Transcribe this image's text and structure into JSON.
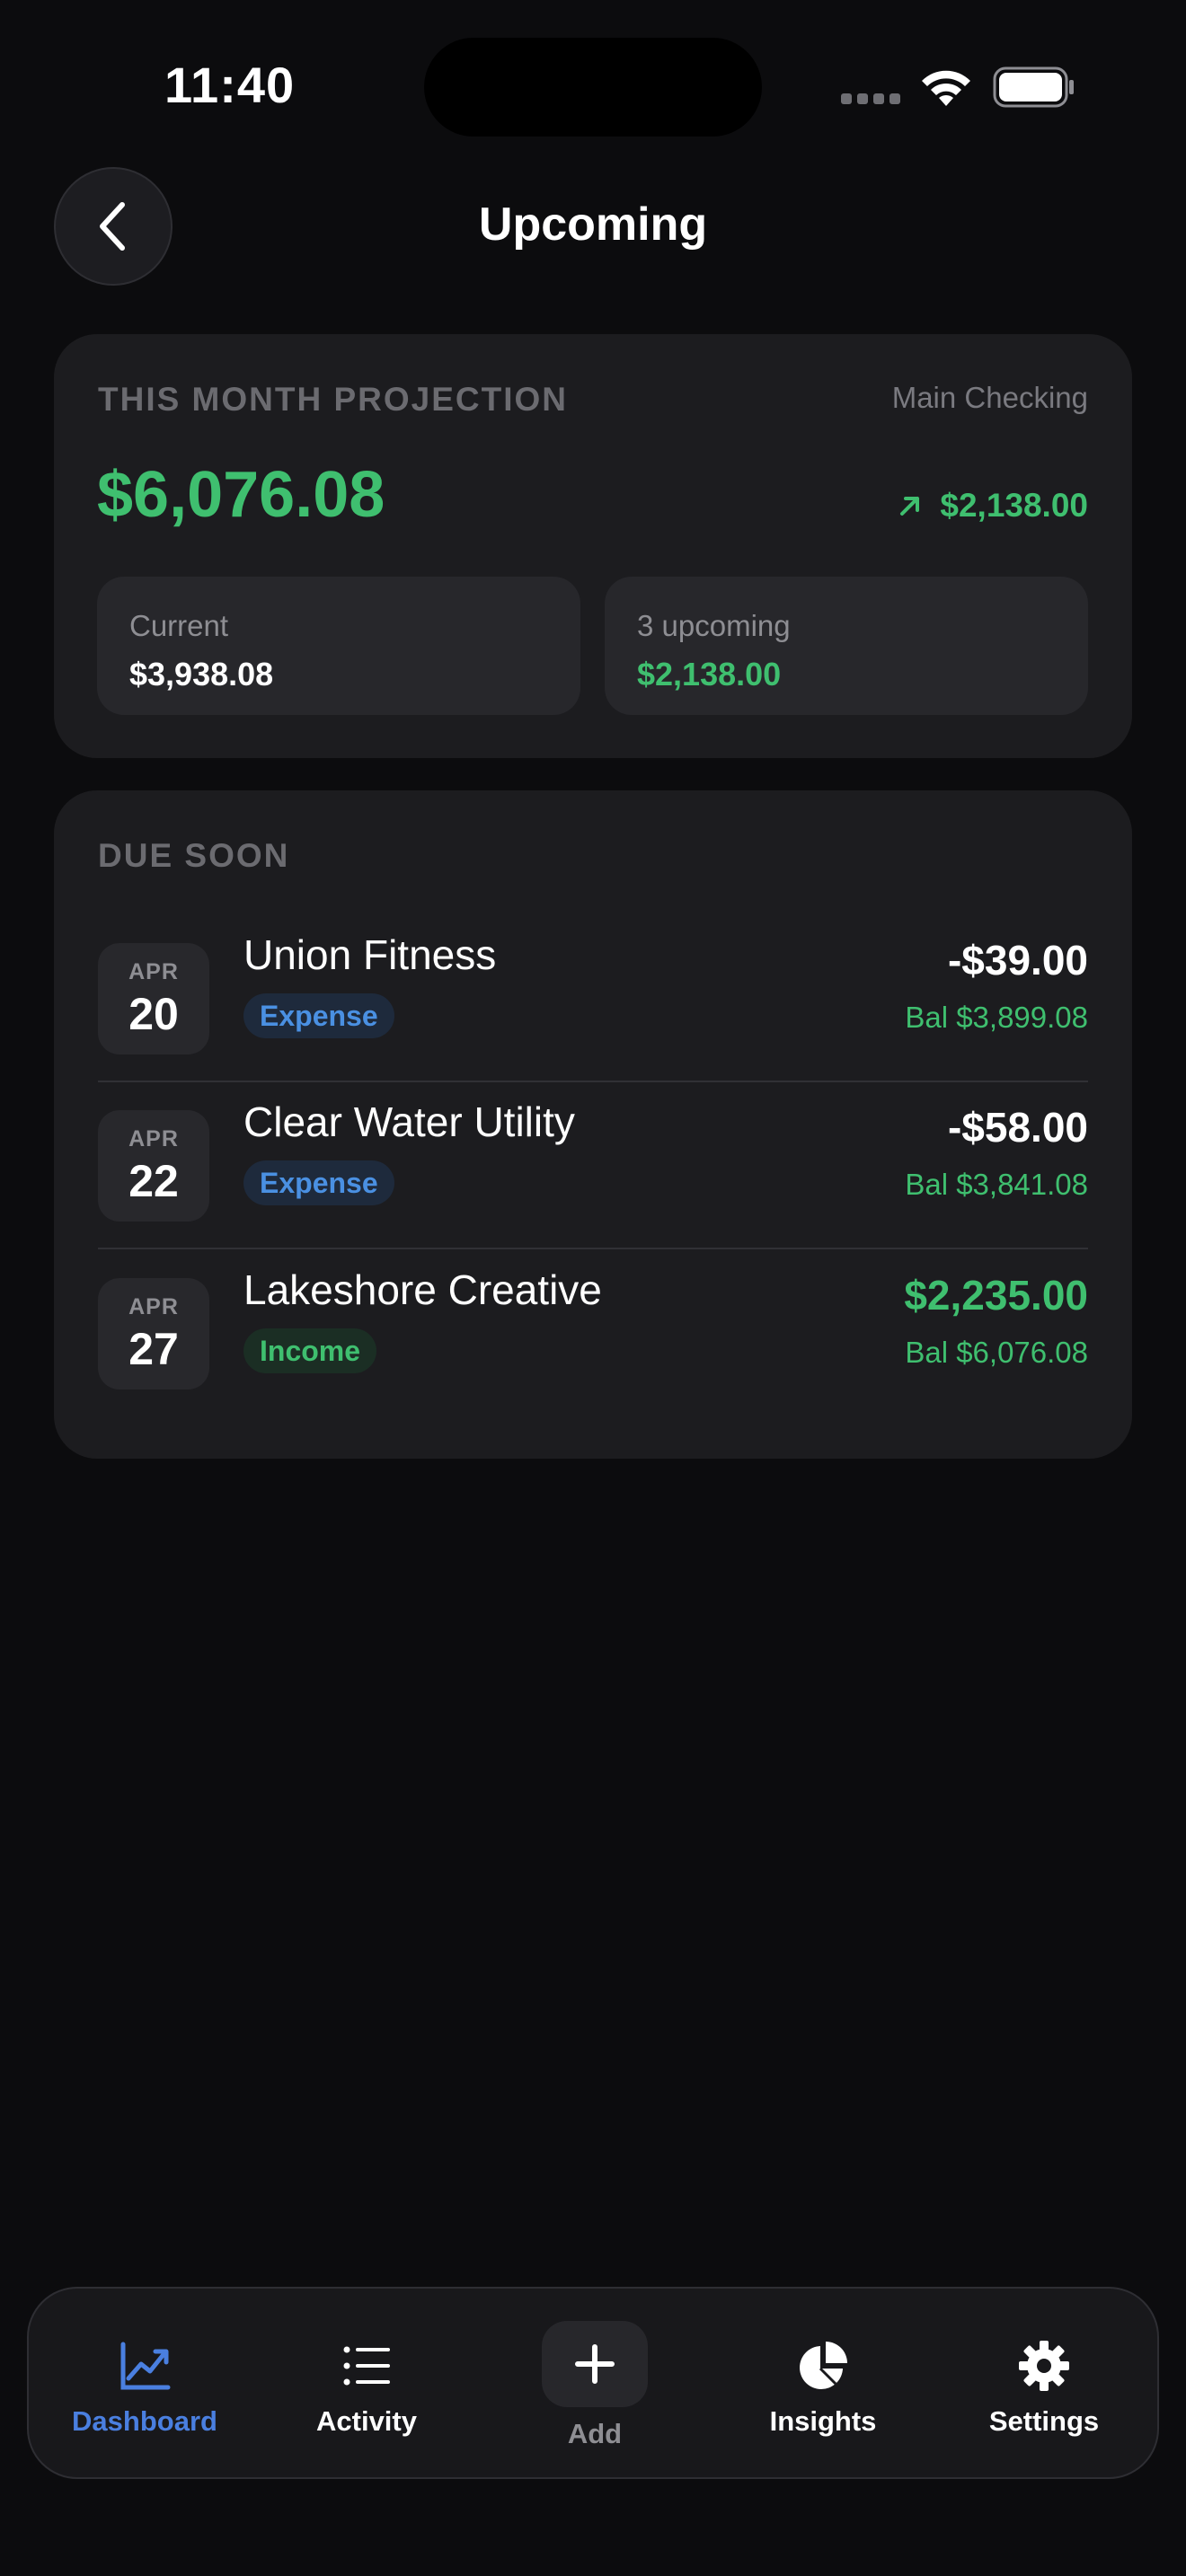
{
  "status_bar": {
    "time": "11:40"
  },
  "header": {
    "title": "Upcoming"
  },
  "projection": {
    "label": "THIS MONTH PROJECTION",
    "account": "Main Checking",
    "amount": "$6,076.08",
    "delta": "$2,138.00",
    "current_label": "Current",
    "current_value": "$3,938.08",
    "upcoming_label": "3 upcoming",
    "upcoming_value": "$2,138.00"
  },
  "due_soon": {
    "label": "DUE SOON",
    "items": [
      {
        "month": "APR",
        "day": "20",
        "payee": "Union Fitness",
        "type": "Expense",
        "amount": "-$39.00",
        "balance": "Bal $3,899.08"
      },
      {
        "month": "APR",
        "day": "22",
        "payee": "Clear Water Utility",
        "type": "Expense",
        "amount": "-$58.00",
        "balance": "Bal $3,841.08"
      },
      {
        "month": "APR",
        "day": "27",
        "payee": "Lakeshore Creative",
        "type": "Income",
        "amount": "$2,235.00",
        "balance": "Bal $6,076.08"
      }
    ]
  },
  "tabbar": {
    "tabs": [
      {
        "label": "Dashboard",
        "icon": "chart-icon",
        "active": true
      },
      {
        "label": "Activity",
        "icon": "list-icon"
      },
      {
        "label": "Add",
        "icon": "plus-icon"
      },
      {
        "label": "Insights",
        "icon": "pie-icon"
      },
      {
        "label": "Settings",
        "icon": "gear-icon"
      }
    ]
  },
  "colors": {
    "background": "#0c0c0e",
    "card": "#1c1c1f",
    "positive": "#3fbf6f",
    "accent_blue": "#4a90e2",
    "muted": "#6b6b70"
  }
}
